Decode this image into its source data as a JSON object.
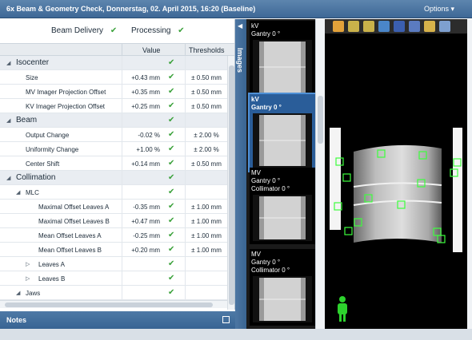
{
  "window": {
    "title": "6x Beam & Geometry Check, Donnerstag, 02. April 2015, 16:20 (Baseline)",
    "options_label": "Options ▾"
  },
  "status": {
    "beam_delivery": "Beam Delivery",
    "processing": "Processing",
    "check": "✔"
  },
  "columns": {
    "value": "Value",
    "thresholds": "Thresholds"
  },
  "rows": [
    {
      "label": "Isocenter",
      "value": "",
      "threshold": "",
      "kind": "section",
      "indent": 0,
      "expander": "◢"
    },
    {
      "label": "Size",
      "value": "+0.43 mm",
      "threshold": "± 0.50 mm",
      "kind": "item",
      "indent": 1,
      "expander": ""
    },
    {
      "label": "MV Imager Projection Offset",
      "value": "+0.35 mm",
      "threshold": "± 0.50 mm",
      "kind": "item",
      "indent": 1,
      "expander": ""
    },
    {
      "label": "KV Imager Projection Offset",
      "value": "+0.25 mm",
      "threshold": "± 0.50 mm",
      "kind": "item",
      "indent": 1,
      "expander": ""
    },
    {
      "label": "Beam",
      "value": "",
      "threshold": "",
      "kind": "section",
      "indent": 0,
      "expander": "◢"
    },
    {
      "label": "Output Change",
      "value": "-0.02 %",
      "threshold": "± 2.00 %",
      "kind": "item",
      "indent": 1,
      "expander": ""
    },
    {
      "label": "Uniformity Change",
      "value": "+1.00 %",
      "threshold": "± 2.00 %",
      "kind": "item",
      "indent": 1,
      "expander": ""
    },
    {
      "label": "Center Shift",
      "value": "+0.14 mm",
      "threshold": "± 0.50 mm",
      "kind": "item",
      "indent": 1,
      "expander": ""
    },
    {
      "label": "Collimation",
      "value": "",
      "threshold": "",
      "kind": "section",
      "indent": 0,
      "expander": "◢"
    },
    {
      "label": "MLC",
      "value": "",
      "threshold": "",
      "kind": "item",
      "indent": 1,
      "expander": "◢"
    },
    {
      "label": "Maximal Offset Leaves A",
      "value": "-0.35 mm",
      "threshold": "± 1.00 mm",
      "kind": "item",
      "indent": 2,
      "expander": ""
    },
    {
      "label": "Maximal Offset Leaves B",
      "value": "+0.47 mm",
      "threshold": "± 1.00 mm",
      "kind": "item",
      "indent": 2,
      "expander": ""
    },
    {
      "label": "Mean Offset Leaves A",
      "value": "-0.25 mm",
      "threshold": "± 1.00 mm",
      "kind": "item",
      "indent": 2,
      "expander": ""
    },
    {
      "label": "Mean Offset Leaves B",
      "value": "+0.20 mm",
      "threshold": "± 1.00 mm",
      "kind": "item",
      "indent": 2,
      "expander": ""
    },
    {
      "label": "Leaves A",
      "value": "",
      "threshold": "",
      "kind": "item",
      "indent": 2,
      "expander": "▷"
    },
    {
      "label": "Leaves B",
      "value": "",
      "threshold": "",
      "kind": "item",
      "indent": 2,
      "expander": "▷"
    },
    {
      "label": "Jaws",
      "value": "",
      "threshold": "",
      "kind": "item",
      "indent": 1,
      "expander": "◢"
    }
  ],
  "side_tab": {
    "arrow": "◀",
    "label": "Images"
  },
  "thumbnails": [
    {
      "line1": "kV",
      "line2": "Gantry 0 °",
      "line3": "",
      "selected": false
    },
    {
      "line1": "kV",
      "line2": "Gantry 0 °",
      "line3": "",
      "selected": true
    },
    {
      "line1": "MV",
      "line2": "Gantry 0 °",
      "line3": "Collimator 0 °",
      "selected": false
    },
    {
      "line1": "MV",
      "line2": "Gantry 0 °",
      "line3": "Collimator 0 °",
      "selected": false
    }
  ],
  "viewer_tools": [
    "pan-hand-icon",
    "zoom-in-icon",
    "zoom-out-icon",
    "undo-icon",
    "contrast-icon",
    "window-level-icon",
    "ruler-icon",
    "overlay-icon"
  ],
  "notes": {
    "label": "Notes"
  },
  "colors": {
    "accent": "#3e6896",
    "check": "#3aa13a",
    "marker": "#3dff3d"
  }
}
